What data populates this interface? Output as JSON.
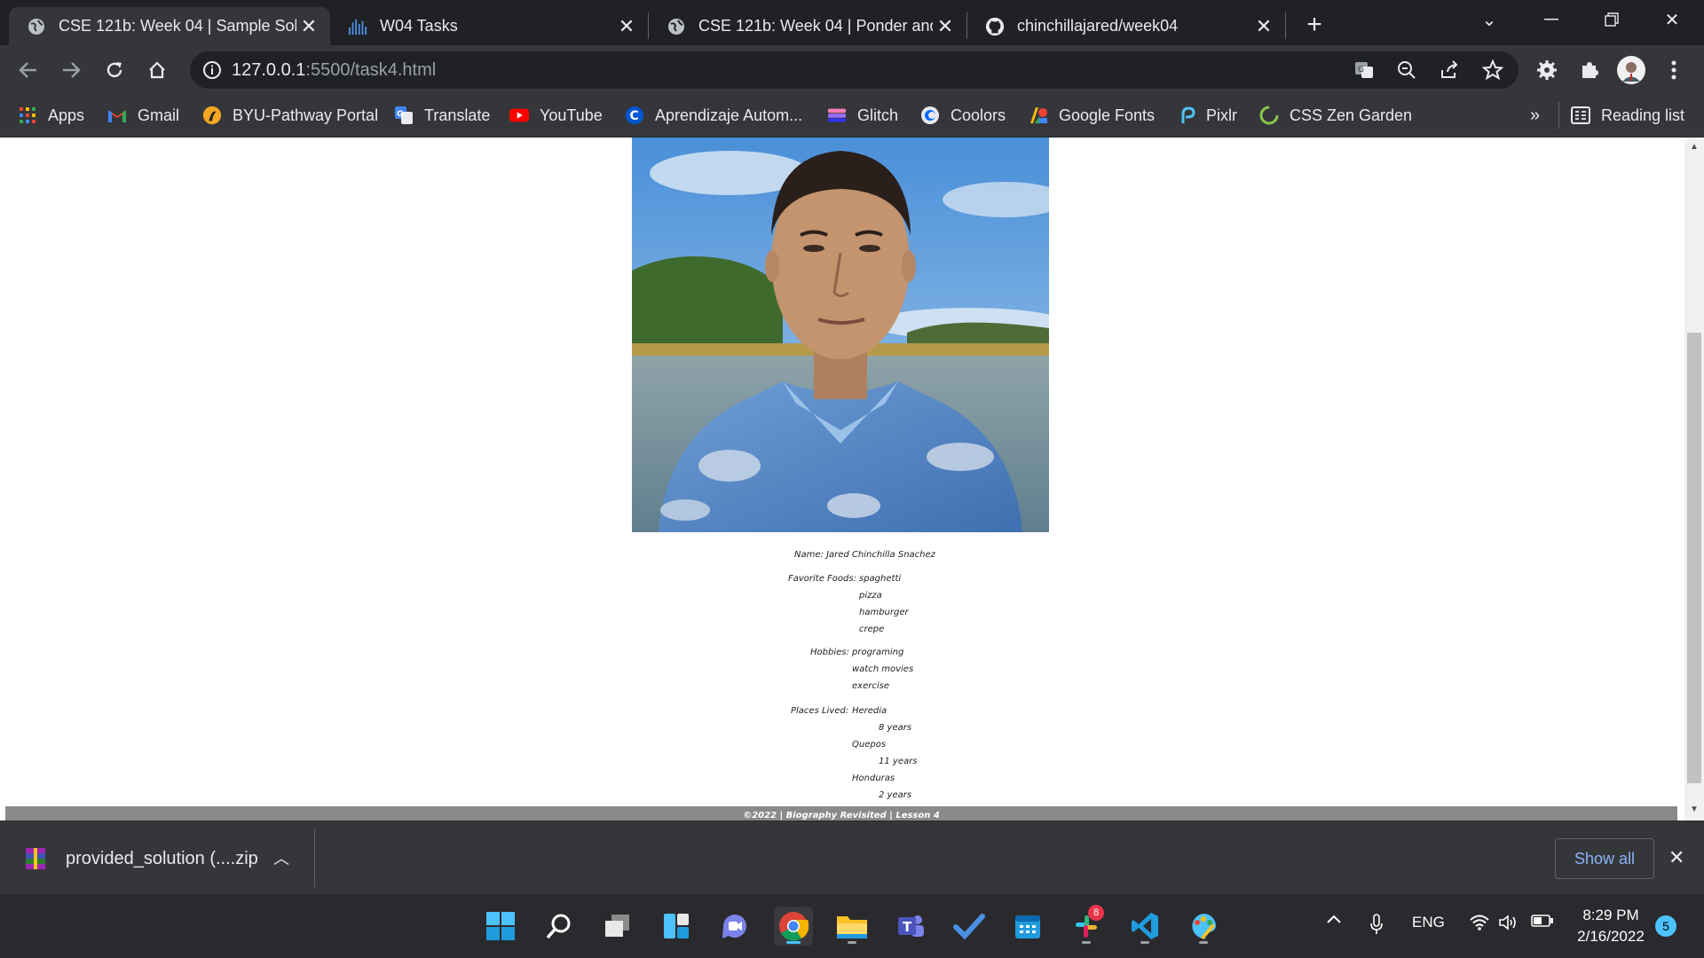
{
  "browser": {
    "tabs": [
      {
        "title": "CSE 121b: Week 04 | Sample Solu",
        "icon": "globe-icon",
        "active": true
      },
      {
        "title": "W04 Tasks",
        "icon": "audio-bars-icon",
        "active": false
      },
      {
        "title": "CSE 121b: Week 04 | Ponder and",
        "icon": "globe-icon",
        "active": false
      },
      {
        "title": "chinchillajared/week04",
        "icon": "github-icon",
        "active": false
      }
    ],
    "new_tab_label": "+",
    "url_host": "127.0.0.1",
    "url_path": ":5500/task4.html"
  },
  "bookmarks": [
    {
      "label": "Apps",
      "icon": "apps-grid-icon"
    },
    {
      "label": "Gmail",
      "icon": "gmail-icon"
    },
    {
      "label": "BYU-Pathway Portal",
      "icon": "byu-pathway-icon"
    },
    {
      "label": "Translate",
      "icon": "translate-icon"
    },
    {
      "label": "YouTube",
      "icon": "youtube-icon"
    },
    {
      "label": "Aprendizaje Autom...",
      "icon": "coursera-icon"
    },
    {
      "label": "Glitch",
      "icon": "glitch-icon"
    },
    {
      "label": "Coolors",
      "icon": "coolors-icon"
    },
    {
      "label": "Google Fonts",
      "icon": "google-fonts-icon"
    },
    {
      "label": "Pixlr",
      "icon": "pixlr-icon"
    },
    {
      "label": "CSS Zen Garden",
      "icon": "css-zen-icon"
    }
  ],
  "bookmarks_overflow": "»",
  "reading_list": "Reading list",
  "page": {
    "name_label": "Name:",
    "name_value": "Jared Chinchilla Snachez",
    "foods_label": "Favorite Foods:",
    "foods": [
      "spaghetti",
      "pizza",
      "hamburger",
      "crepe"
    ],
    "hobbies_label": "Hobbies:",
    "hobbies": [
      "programing",
      "watch movies",
      "exercise"
    ],
    "places_label": "Places Lived:",
    "places": [
      {
        "place": "Heredia",
        "length": "8 years"
      },
      {
        "place": "Quepos",
        "length": "11 years"
      },
      {
        "place": "Honduras",
        "length": "2 years"
      }
    ],
    "footer": "©2022 | Biography Revisited | Lesson 4"
  },
  "download": {
    "filename": "provided_solution (....zip",
    "show_all": "Show all"
  },
  "taskbar": {
    "language": "ENG",
    "time": "8:29 PM",
    "date": "2/16/2022",
    "notification_count": "5",
    "slack_badge": "8"
  }
}
